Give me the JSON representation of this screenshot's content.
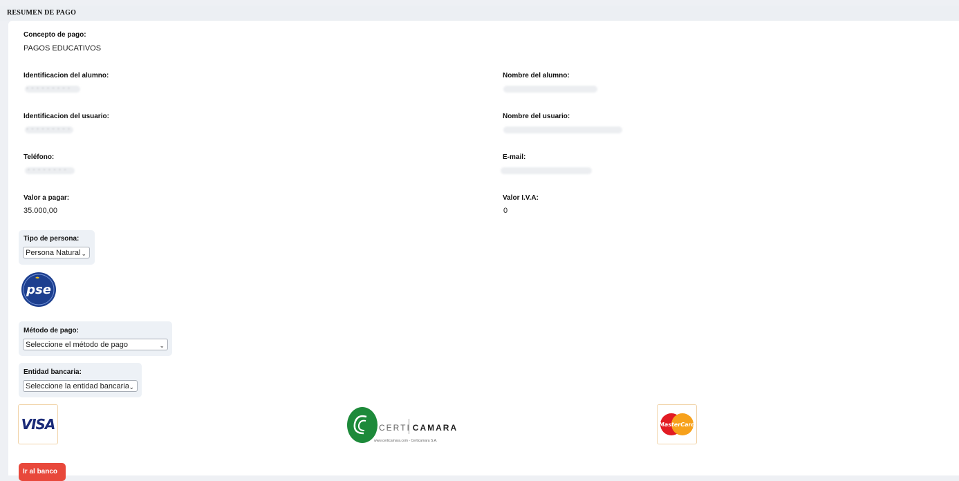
{
  "header": {
    "title": "RESUMEN DE PAGO"
  },
  "concepto": {
    "label": "Concepto de pago:",
    "value": "PAGOS EDUCATIVOS"
  },
  "alumno": {
    "id_label": "Identificacion del alumno:",
    "id_value": "· · · · · · · · ·",
    "name_label": "Nombre del alumno:"
  },
  "usuario": {
    "id_label": "Identificacion del usuario:",
    "id_value": "· · · · · · · · ·",
    "name_label": "Nombre del usuario:"
  },
  "contacto": {
    "phone_label": "Teléfono:",
    "phone_value": "· · · · · · · ·",
    "email_label": "E-mail:"
  },
  "valores": {
    "pagar_label": "Valor a pagar:",
    "pagar_value": "35.000,00",
    "iva_label": "Valor I.V.A:",
    "iva_value": "0"
  },
  "tipo_persona": {
    "label": "Tipo de persona:",
    "selected": "Persona Natural"
  },
  "pse": {
    "text": "pse"
  },
  "metodo_pago": {
    "label": "Método de pago:",
    "selected": "Seleccione el método de pago"
  },
  "entidad_bancaria": {
    "label": "Entidad bancaria:",
    "selected": "Seleccione la entidad bancaria"
  },
  "logos": {
    "visa": "VISA",
    "certicamara_left": "CERTI",
    "certicamara_right": "CAMARA",
    "certicamara_sub": "www.certicamara.com - Certicamara S.A.",
    "mastercard": "MasterCard"
  },
  "actions": {
    "bank_button": "Ir al banco"
  },
  "colors": {
    "button": "#e8483b",
    "pse_blue": "#1d3f8f",
    "certicamara_green": "#1d8a3a",
    "mastercard_red": "#e21b23",
    "mastercard_yellow": "#f7a11b"
  }
}
